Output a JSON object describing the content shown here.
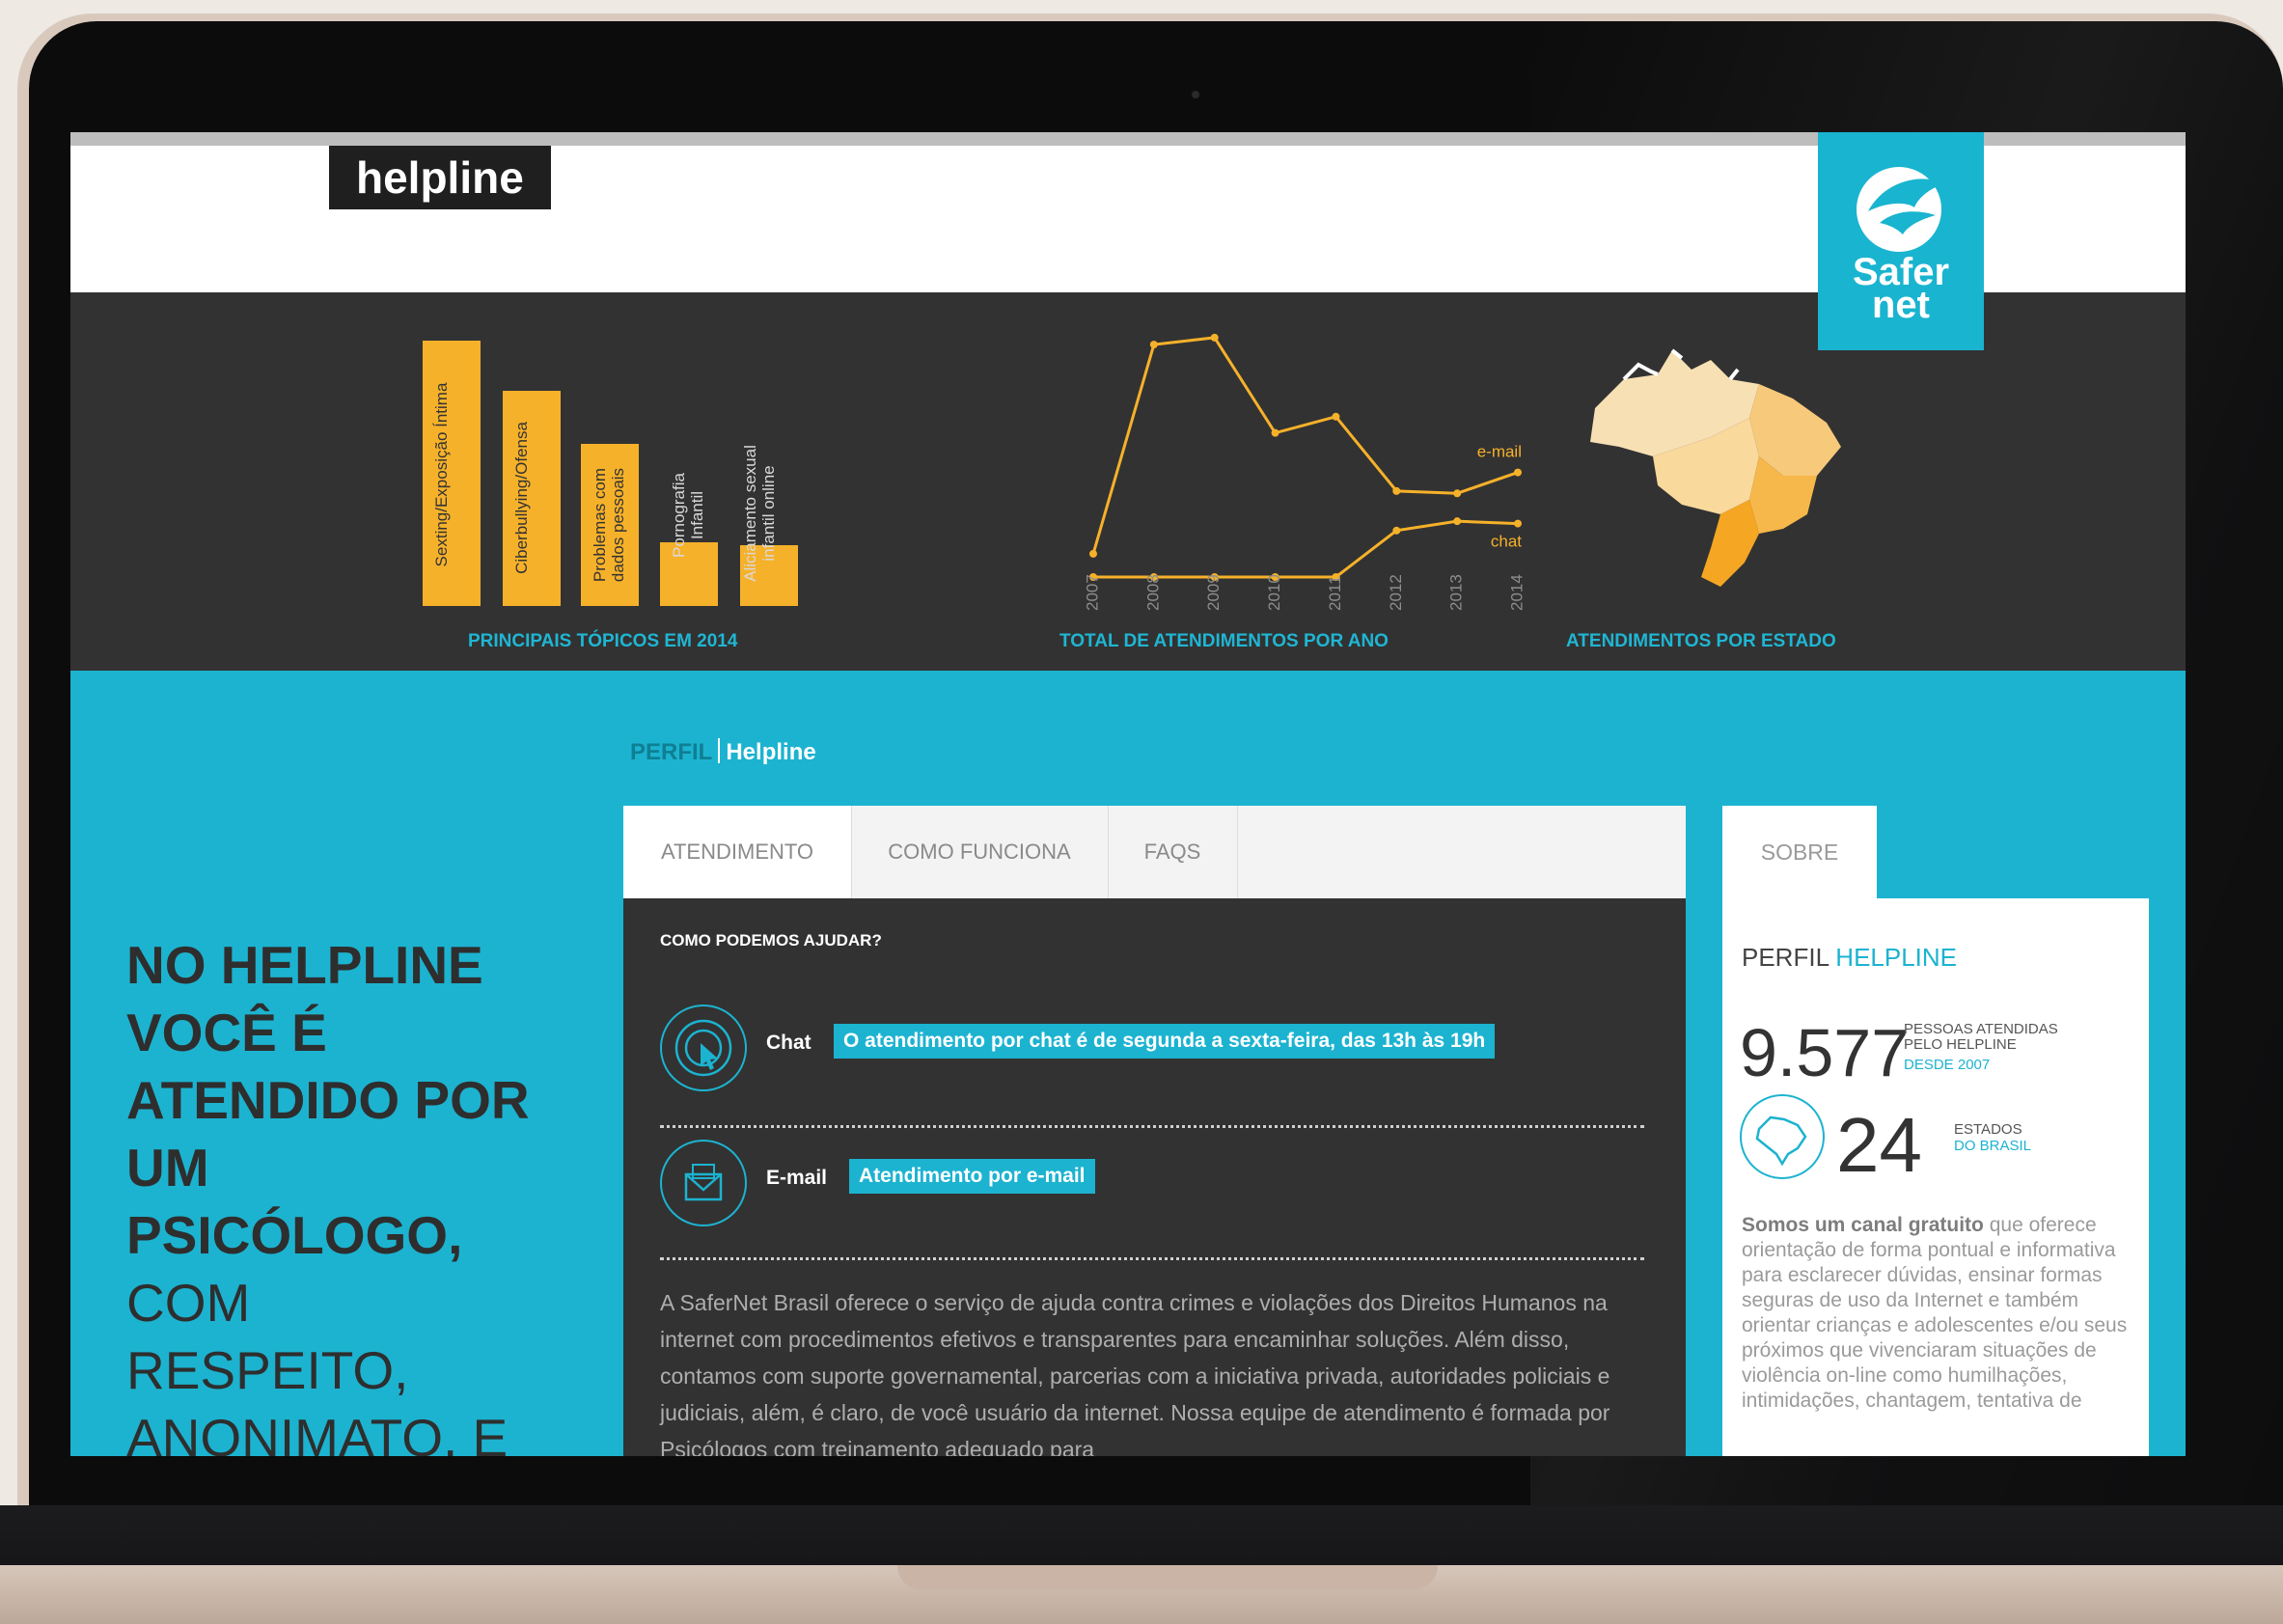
{
  "brand": {
    "label": "helpline",
    "logo_line1": "Safer",
    "logo_line2": "net"
  },
  "stats": {
    "captions": {
      "topics": "PRINCIPAIS TÓPICOS EM 2014",
      "years": "TOTAL DE ATENDIMENTOS POR ANO",
      "states": "ATENDIMENTOS POR ESTADO"
    }
  },
  "chart_data": [
    {
      "type": "bar",
      "title": "PRINCIPAIS TÓPICOS EM 2014",
      "categories": [
        "Sexting/Exposição Íntima",
        "Ciberbullying/Ofensa",
        "Problemas com dados pessoais",
        "Pornografia Infantil",
        "Aliciamento sexual infantil online"
      ],
      "values": [
        100,
        81,
        61,
        24,
        23
      ]
    },
    {
      "type": "line",
      "title": "TOTAL DE ATENDIMENTOS POR ANO",
      "x": [
        "2007",
        "2008",
        "2009",
        "2010",
        "2011",
        "2012",
        "2013",
        "2014"
      ],
      "series": [
        {
          "name": "e-mail",
          "values": [
            10,
            100,
            103,
            62,
            69,
            37,
            36,
            45
          ]
        },
        {
          "name": "chat",
          "values": [
            0,
            0,
            0,
            0,
            0,
            20,
            24,
            23
          ]
        }
      ],
      "ylim": [
        0,
        110
      ]
    }
  ],
  "breadcrumb": {
    "section": "PERFIL",
    "page": "Helpline"
  },
  "hero": {
    "bold": "NO HELPLINE VOCÊ É ATENDIDO POR UM PSICÓLOGO,",
    "rest": "COM RESPEITO, ANONIMATO, E"
  },
  "tabs": [
    "ATENDIMENTO",
    "COMO FUNCIONA",
    "FAQS"
  ],
  "content": {
    "question": "COMO PODEMOS AJUDAR?",
    "chat": {
      "label": "Chat",
      "info": "O atendimento por chat é de segunda a sexta-feira, das 13h às 19h"
    },
    "email": {
      "label": "E-mail",
      "info": "Atendimento por e-mail"
    },
    "body": "A SaferNet Brasil oferece o serviço de ajuda contra crimes e violações dos Direitos Humanos na internet com procedimentos efetivos e transparentes para encaminhar soluções. Além disso, contamos com suporte governamental, parcerias com a iniciativa privada, autoridades policiais e judiciais, além, é claro, de você usuário da internet. Nossa equipe de atendimento é formada por Psicólogos com treinamento adequado para"
  },
  "sidebar": {
    "tab": "SOBRE",
    "title_a": "PERFIL",
    "title_b": "HELPLINE",
    "people_count": "9.577",
    "people_label": "PESSOAS ATENDIDAS PELO HELPLINE",
    "people_since": "DESDE 2007",
    "states_count": "24",
    "states_label": "ESTADOS",
    "states_sub": "DO BRASIL",
    "text_bold": "Somos um canal gratuito",
    "text": " que oferece orientação de forma pontual e informativa para esclarecer dúvidas, ensinar formas seguras de uso da Internet e também orientar crianças e adolescentes e/ou seus próximos que vivenciaram situações de violência on-line como humilhações, intimidações, chantagem, tentativa de"
  },
  "colors": {
    "accent": "#1cb3d0",
    "bar": "#f6b12a",
    "dark": "#323232"
  }
}
